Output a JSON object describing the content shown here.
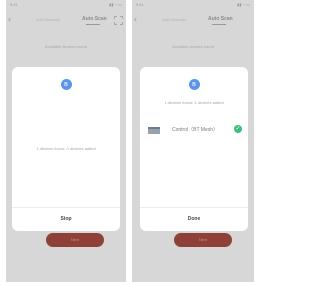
{
  "left": {
    "status_time": "9:41",
    "status_icons": "▮▮ ◔ ▭",
    "nav": {
      "back": "‹",
      "tab_manual": "Add Manually",
      "tab_auto": "Auto Scan"
    },
    "found_banner": "Available devices found",
    "dialog": {
      "message": "1 devices found, 0 devices added",
      "button": "Stop"
    },
    "bottom_button": "Next"
  },
  "right": {
    "status_time": "9:41",
    "status_icons": "▮▮ ◔ ▭",
    "nav": {
      "back": "‹",
      "tab_manual": "Add Manually",
      "tab_auto": "Auto Scan"
    },
    "found_banner": "Available devices found",
    "dialog": {
      "message": "1 devices found, 1 devices added",
      "device_name": "Control（BT Mesh）",
      "button": "Done"
    },
    "bottom_button": "Next"
  },
  "icons": {
    "bluetooth": "bluetooth-icon",
    "check": "check-icon",
    "scan": "scan-icon",
    "back": "back-arrow-icon"
  },
  "colors": {
    "bluetooth_blue": "#5a95ea",
    "success_green": "#3cbf78",
    "button_red": "#8f4038",
    "overlay_gray": "#d7d7d7"
  }
}
